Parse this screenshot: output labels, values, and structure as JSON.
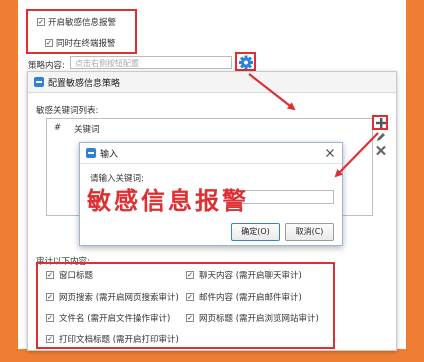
{
  "top_options": {
    "enable_label": "开启敏感信息报警",
    "endpoint_label": "同时在终端报警",
    "enable_checked": true,
    "endpoint_checked": true
  },
  "policy": {
    "label": "策略内容:",
    "placeholder": "点击右侧按钮配置"
  },
  "policy_dialog": {
    "title": "配置敏感信息策略",
    "keyword_list_label": "敏感关键词列表:",
    "columns": [
      "#",
      "关键词"
    ],
    "audit_label": "审计以下内容:",
    "audit_items": [
      {
        "label": "窗口标题",
        "checked": true
      },
      {
        "label": "聊天内容 (需开启聊天审计)",
        "checked": true
      },
      {
        "label": "网页搜索 (需开启网页搜索审计)",
        "checked": true
      },
      {
        "label": "邮件内容 (需开启邮件审计)",
        "checked": true
      },
      {
        "label": "文件名 (需开启文件操作审计)",
        "checked": true
      },
      {
        "label": "网页标题 (需开启浏览网站审计)",
        "checked": true
      },
      {
        "label": "打印文档标题 (需开启打印审计)",
        "checked": true
      }
    ]
  },
  "input_dialog": {
    "title": "输入",
    "prompt": "请输入关键词:",
    "value": "敏感信息报警",
    "ok_label": "确定(O)",
    "cancel_label": "取消(C)"
  },
  "icons": {
    "gear": "gear-icon",
    "add": "plus-icon",
    "edit": "pencil-icon",
    "delete": "delete-x-icon",
    "close": "close-icon"
  },
  "colors": {
    "frame": "#ef7d31",
    "highlight": "#e02f32",
    "accent": "#2f80d8"
  }
}
